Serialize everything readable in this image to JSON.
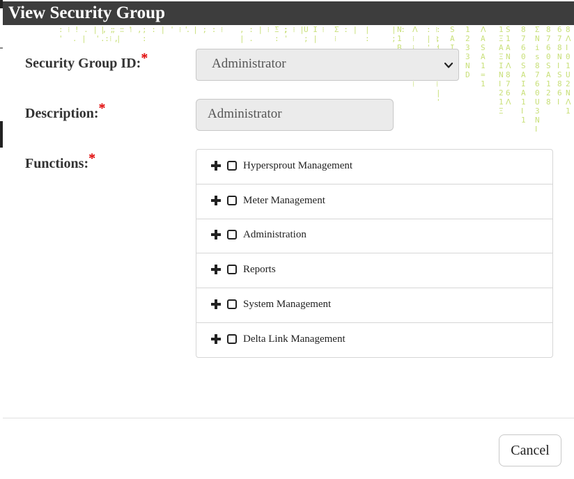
{
  "modal": {
    "title": "View Security Group"
  },
  "form": {
    "security_group_id": {
      "label": "Security Group ID:",
      "required_marker": "*",
      "value": "Administrator"
    },
    "description": {
      "label": "Description:",
      "required_marker": "*",
      "value": "Administrator"
    },
    "functions": {
      "label": "Functions:",
      "required_marker": "*",
      "items": [
        {
          "label": "Hypersprout Management",
          "checked": false
        },
        {
          "label": "Meter Management",
          "checked": false
        },
        {
          "label": "Administration",
          "checked": false
        },
        {
          "label": "Reports",
          "checked": false
        },
        {
          "label": "System Management",
          "checked": false
        },
        {
          "label": "Delta Link Management",
          "checked": false
        }
      ]
    }
  },
  "footer": {
    "cancel_label": "Cancel"
  },
  "colors": {
    "header_bg": "#3d3d3d",
    "required": "#e00000",
    "readonly_field_bg": "#ebebeb",
    "texture": "#c9e07a"
  }
}
